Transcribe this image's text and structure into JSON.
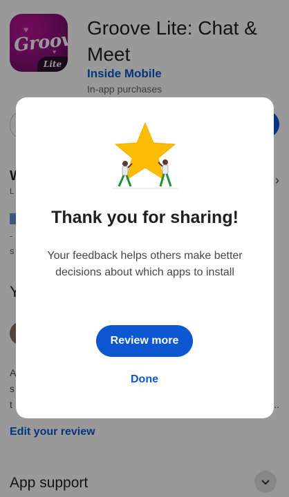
{
  "app": {
    "title": "Groove Lite: Chat & Meet",
    "developer": "Inside Mobile",
    "in_app_purchases": "In-app purchases",
    "icon": {
      "logo_text": "Groove",
      "badge_text": "Lite",
      "colors": {
        "background": "#8c0f7d",
        "badge": "#2b1130"
      }
    }
  },
  "background_fragments": {
    "w": "W",
    "l": "L",
    "dash": "-",
    "s": "s",
    "y": "Y",
    "a": "A",
    "s2": "s",
    "t": "t",
    "dots": "..."
  },
  "reviews": {
    "edit_review_label": "Edit your review"
  },
  "app_support": {
    "label": "App support",
    "chevron_icon": "chevron-down-icon"
  },
  "dialog": {
    "illustration_icon": "star-with-people-icon",
    "title": "Thank you for sharing!",
    "body": "Your feedback helps others make better decisions about which apps to install",
    "review_more_label": "Review more",
    "done_label": "Done"
  },
  "colors": {
    "accent": "#0b57d0",
    "star": "#fbbc04",
    "scrim": "rgba(0,0,0,0.40)"
  }
}
